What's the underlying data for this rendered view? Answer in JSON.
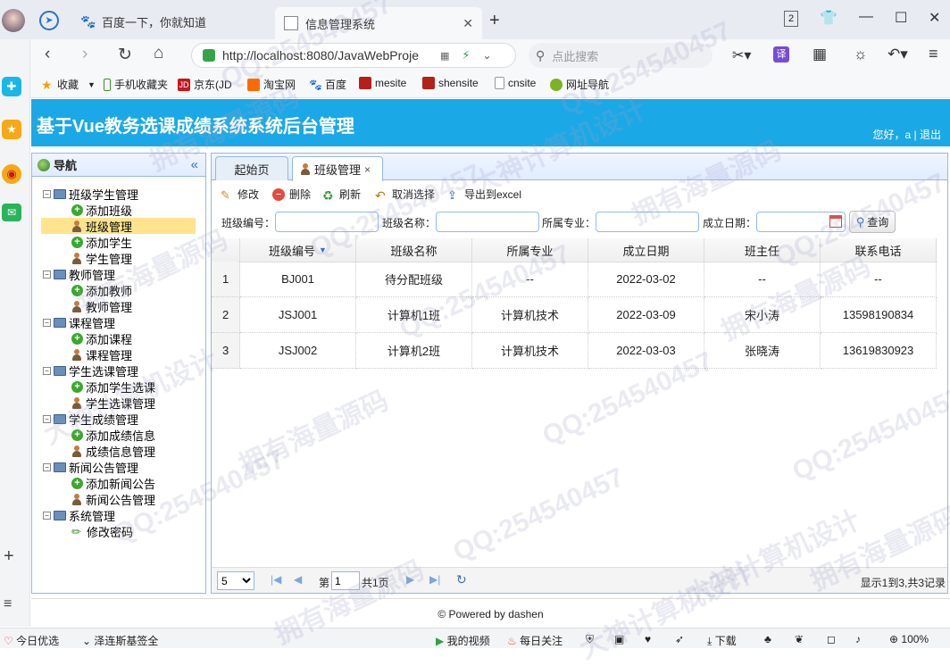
{
  "browser": {
    "tabs": [
      {
        "title": "百度一下，你就知道"
      },
      {
        "title": "信息管理系统"
      }
    ],
    "tab_count": "2",
    "url": "http://localhost:8080/JavaWebProje",
    "search_placeholder": "点此搜索",
    "bookmarks": [
      "收藏",
      "手机收藏夹",
      "京东(JD",
      "淘宝网",
      "百度",
      "mesite",
      "shensite",
      "cnsite",
      "网址导航"
    ],
    "statusbar": {
      "left1": "今日优选",
      "left2": "泽连斯基签全",
      "video": "我的视频",
      "daily": "每日关注",
      "download": "下载",
      "zoom": "100%"
    }
  },
  "app": {
    "title": "基于Vue教务选课成绩系统系统后台管理",
    "user_text": "您好，a | 退出",
    "footer": "© Powered by dashen"
  },
  "sidebar": {
    "header": "导航",
    "collapse_glyph": "«",
    "groups": [
      {
        "label": "班级学生管理",
        "items": [
          "添加班级",
          "班级管理",
          "添加学生",
          "学生管理"
        ]
      },
      {
        "label": "教师管理",
        "items": [
          "添加教师",
          "教师管理"
        ]
      },
      {
        "label": "课程管理",
        "items": [
          "添加课程",
          "课程管理"
        ]
      },
      {
        "label": "学生选课管理",
        "items": [
          "添加学生选课",
          "学生选课管理"
        ]
      },
      {
        "label": "学生成绩管理",
        "items": [
          "添加成绩信息",
          "成绩信息管理"
        ]
      },
      {
        "label": "新闻公告管理",
        "items": [
          "添加新闻公告",
          "新闻公告管理"
        ]
      },
      {
        "label": "系统管理",
        "items": [
          "修改密码"
        ]
      }
    ],
    "selected": "班级管理"
  },
  "main": {
    "tabs": [
      {
        "label": "起始页"
      },
      {
        "label": "班级管理",
        "close": "×"
      }
    ],
    "toolbar": {
      "edit": "修改",
      "delete": "删除",
      "refresh": "刷新",
      "cancel_select": "取消选择",
      "export": "导出到excel"
    },
    "filters": {
      "class_no": "班级编号：",
      "class_name": "班级名称：",
      "major": "所属专业：",
      "date": "成立日期：",
      "query": "查询"
    },
    "table": {
      "columns": [
        "班级编号",
        "班级名称",
        "所属专业",
        "成立日期",
        "班主任",
        "联系电话"
      ],
      "rows": [
        {
          "n": "1",
          "cells": [
            "BJ001",
            "待分配班级",
            "--",
            "2022-03-02",
            "--",
            "--"
          ]
        },
        {
          "n": "2",
          "cells": [
            "JSJ001",
            "计算机1班",
            "计算机技术",
            "2022-03-09",
            "宋小涛",
            "13598190834"
          ]
        },
        {
          "n": "3",
          "cells": [
            "JSJ002",
            "计算机2班",
            "计算机技术",
            "2022-03-03",
            "张晓涛",
            "13619830923"
          ]
        }
      ]
    },
    "pager": {
      "page_size": "5",
      "page_label": "第",
      "page_value": "1",
      "total_pages": "共1页",
      "summary": "显示1到3,共3记录"
    }
  },
  "watermarks": [
    "大神计算机设计",
    "QQ:254540457",
    "拥有海量源码"
  ]
}
